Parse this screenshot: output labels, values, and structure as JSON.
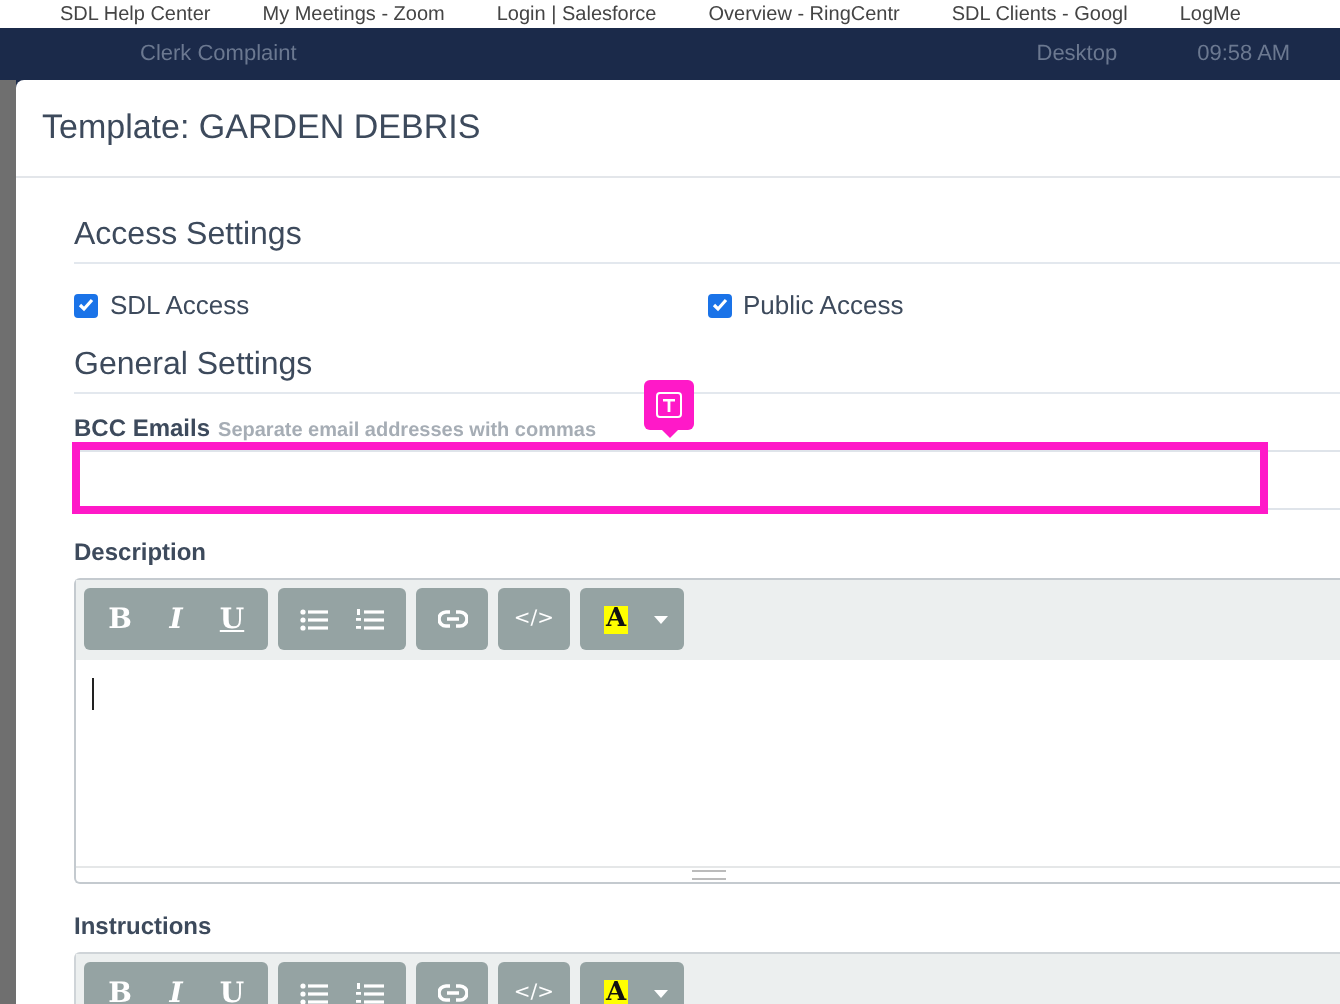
{
  "bookmarks": [
    "SDL Help Center",
    "My Meetings - Zoom",
    "Login | Salesforce",
    "Overview - RingCentr",
    "SDL Clients - Googl",
    "LogMe"
  ],
  "app_header": {
    "title": "Clerk Complaint",
    "location": "Desktop",
    "time": "09:58 AM"
  },
  "modal": {
    "title": "Template: GARDEN DEBRIS",
    "access_settings": {
      "heading": "Access Settings",
      "options": [
        {
          "label": "SDL Access",
          "checked": true
        },
        {
          "label": "Public Access",
          "checked": true
        }
      ]
    },
    "general_settings": {
      "heading": "General Settings",
      "bcc_emails": {
        "label": "BCC Emails",
        "hint": "Separate email addresses with commas",
        "highlighted": true
      },
      "editors": [
        {
          "label": "Description",
          "focused": true,
          "toolbar": [
            [
              {
                "kind": "bold",
                "label": "B"
              },
              {
                "kind": "italic",
                "label": "I"
              },
              {
                "kind": "underline",
                "label": "U"
              }
            ],
            [
              {
                "kind": "bullets"
              },
              {
                "kind": "numbers"
              }
            ],
            [
              {
                "kind": "link"
              }
            ],
            [
              {
                "kind": "code",
                "label": "</>"
              }
            ],
            [
              {
                "kind": "highlight",
                "label": "A"
              },
              {
                "kind": "caret"
              }
            ]
          ]
        },
        {
          "label": "Instructions",
          "toolbar": [
            [
              {
                "kind": "bold",
                "label": "B"
              },
              {
                "kind": "italic",
                "label": "I"
              },
              {
                "kind": "underline",
                "label": "U"
              }
            ],
            [
              {
                "kind": "bullets"
              },
              {
                "kind": "numbers"
              }
            ],
            [
              {
                "kind": "link"
              }
            ],
            [
              {
                "kind": "code",
                "label": "</>"
              }
            ],
            [
              {
                "kind": "highlight",
                "label": "A"
              },
              {
                "kind": "caret"
              }
            ]
          ]
        }
      ]
    }
  }
}
